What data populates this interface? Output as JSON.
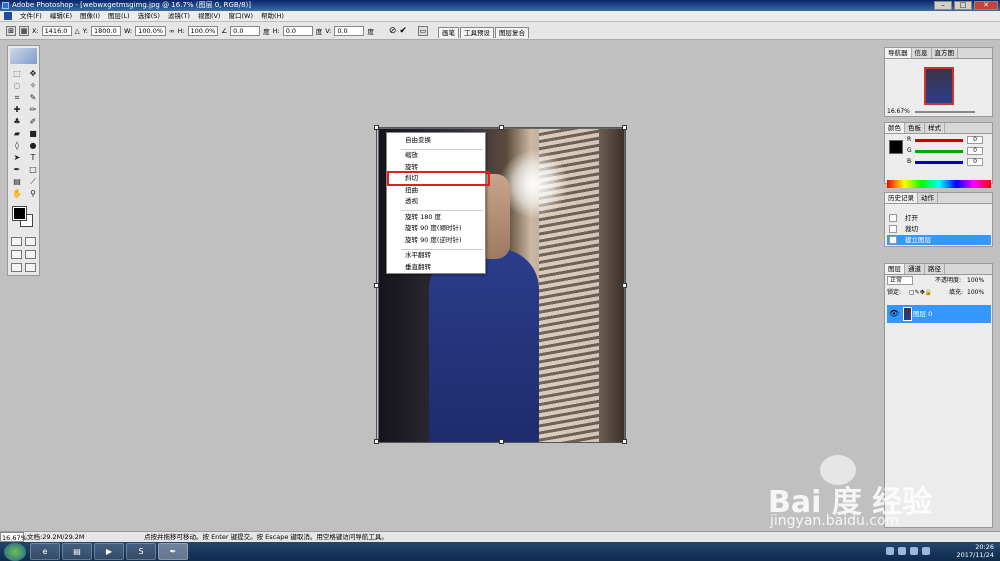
{
  "window": {
    "title": "Adobe Photoshop - [webwxgetmsgimg.jpg @ 16.7% (图层 0, RGB/8)]",
    "buttons": [
      "–",
      "□",
      "✕"
    ]
  },
  "menubar": [
    "文件(F)",
    "编辑(E)",
    "图像(I)",
    "图层(L)",
    "选择(S)",
    "滤镜(T)",
    "视图(V)",
    "窗口(W)",
    "帮助(H)"
  ],
  "options": {
    "x_label": "X:",
    "x_value": "1416.0",
    "y_label": "Y:",
    "y_value": "1800.0",
    "w_label": "W:",
    "w_value": "100.0%",
    "h_label": "H:",
    "h_value": "100.0%",
    "angle_value": "0.0",
    "angle_unit": "度",
    "hskew_label": "H:",
    "hskew_value": "0.0",
    "hskew_unit": "度",
    "vskew_label": "V:",
    "vskew_value": "0.0",
    "vskew_unit": "度",
    "cancel_icon": "⊘",
    "commit_icon": "✔"
  },
  "palette_wells": [
    "画笔",
    "工具预设",
    "图层复合"
  ],
  "context_menu": {
    "items": [
      "自由变换",
      "缩放",
      "旋转",
      "斜切",
      "扭曲",
      "透视",
      "旋转 180 度",
      "旋转 90 度(顺时针)",
      "旋转 90 度(逆时针)",
      "水平翻转",
      "垂直翻转"
    ],
    "highlighted": "斜切"
  },
  "navigator": {
    "tabs": [
      "导航器",
      "信息",
      "直方图"
    ],
    "zoom": "16.67%"
  },
  "color_panel": {
    "tabs": [
      "颜色",
      "色板",
      "样式"
    ],
    "channels": [
      {
        "label": "R",
        "value": "0",
        "color": "#cc0000"
      },
      {
        "label": "G",
        "value": "0",
        "color": "#00aa00"
      },
      {
        "label": "B",
        "value": "0",
        "color": "#0000cc"
      }
    ]
  },
  "history_panel": {
    "tabs": [
      "历史记录",
      "动作"
    ],
    "items": [
      "打开",
      "裁切",
      "建立图层"
    ],
    "selected": "建立图层"
  },
  "layers_panel": {
    "tabs": [
      "图层",
      "通道",
      "路径"
    ],
    "blend_mode": "正常",
    "opacity_label": "不透明度:",
    "opacity_value": "100%",
    "lock_label": "锁定:",
    "fill_label": "填充:",
    "fill_value": "100%",
    "layer_name": "图层 0"
  },
  "statusbar": {
    "zoom": "16.67%",
    "doc_size": "文档:29.2M/29.2M",
    "hint": "点按并拖移可移动。按 Enter 键提交。按 Escape 键取消。用空格键访问导航工具。"
  },
  "taskbar": {
    "time": "20:26",
    "date": "2017/11/24"
  },
  "watermark": {
    "logo": "Bai 度 经验",
    "url": "jingyan.baidu.com"
  },
  "colors": {
    "accent": "#3399ff",
    "highlight_border": "#e02020",
    "title_bar": "#0a246a"
  }
}
